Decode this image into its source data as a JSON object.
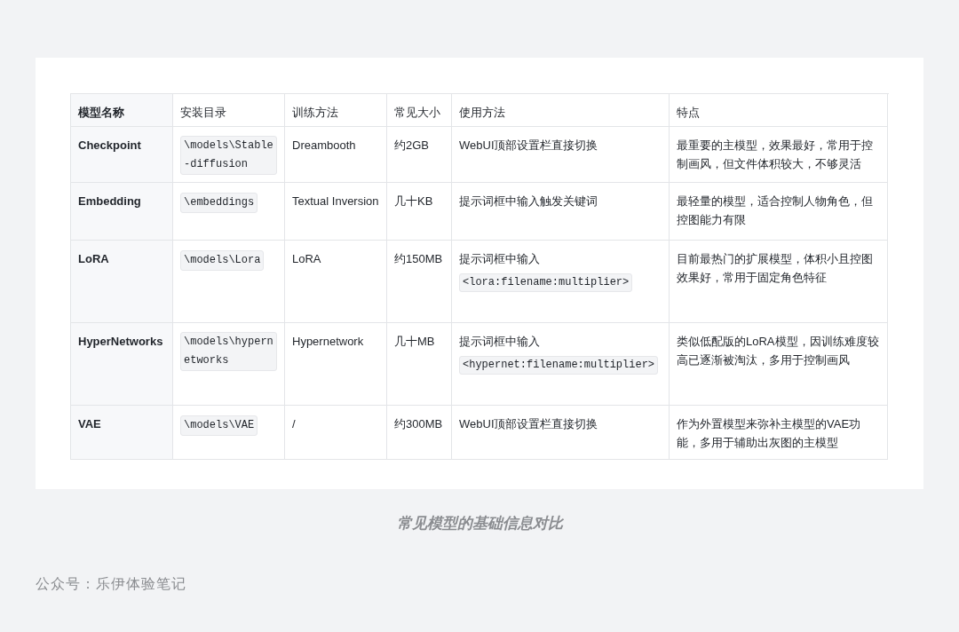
{
  "table": {
    "columns": [
      "模型名称",
      "安装目录",
      "训练方法",
      "常见大小",
      "使用方法",
      "特点"
    ],
    "rows": [
      {
        "name": "Checkpoint",
        "directory": "\\models\\Stable-diffusion",
        "training": "Dreambooth",
        "size": "约2GB",
        "usage": "WebUI顶部设置栏直接切换",
        "features": "最重要的主模型，效果最好，常用于控制画风，但文件体积较大，不够灵活"
      },
      {
        "name": "Embedding",
        "directory": "\\embeddings",
        "training": "Textual Inversion",
        "size": "几十KB",
        "usage": "提示词框中输入触发关键词",
        "features": "最轻量的模型，适合控制人物角色，但控图能力有限"
      },
      {
        "name": "LoRA",
        "directory": "\\models\\Lora",
        "training": "LoRA",
        "size": "约150MB",
        "usage": "提示词框中输入",
        "usage_code": "<lora:filename:multiplier>",
        "features": "目前最热门的扩展模型，体积小且控图效果好，常用于固定角色特征"
      },
      {
        "name": "HyperNetworks",
        "directory": "\\models\\hypernetworks",
        "training": "Hypernetwork",
        "size": "几十MB",
        "usage": "提示词框中输入",
        "usage_code": "<hypernet:filename:multiplier>",
        "features": "类似低配版的LoRA模型，因训练难度较高已逐渐被淘汰，多用于控制画风"
      },
      {
        "name": "VAE",
        "directory": "\\models\\VAE",
        "training": "/",
        "size": "约300MB",
        "usage": "WebUI顶部设置栏直接切换",
        "features": "作为外置模型来弥补主模型的VAE功能，多用于辅助出灰图的主模型"
      }
    ]
  },
  "caption": "常见模型的基础信息对比",
  "footer": "公众号：乐伊体验笔记"
}
